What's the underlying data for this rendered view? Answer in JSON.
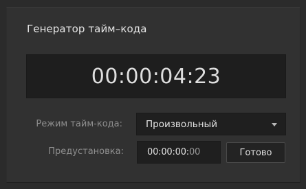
{
  "panel": {
    "title": "Генератор тайм–кода"
  },
  "display": {
    "timecode": "00:00:04:23"
  },
  "mode": {
    "label": "Режим тайм-кода:",
    "selected": "Произвольный"
  },
  "preset": {
    "label": "Предустановка:",
    "value_main": "00:00:00:",
    "value_dim": "00",
    "button_label": "Готово"
  }
}
